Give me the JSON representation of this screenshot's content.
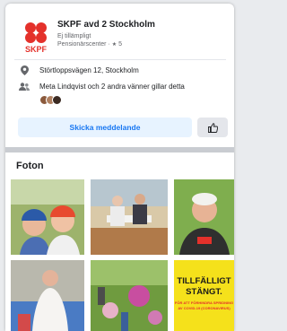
{
  "page": {
    "name": "SKPF avd 2 Stockholm",
    "status": "Ej tillämpligt",
    "category": "Pensionärscenter",
    "rating": "5",
    "logo_text": "SKPF"
  },
  "info": {
    "address": "Störtloppsvägen 12, Stockholm",
    "likes_text": "Meta Lindqvist och 2 andra vänner gillar detta"
  },
  "actions": {
    "message_label": "Skicka meddelande"
  },
  "photos": {
    "title": "Foton",
    "sign": {
      "line1": "TILLFÄLLIGT",
      "line2": "STÄNGT.",
      "line3": "FÖR ATT FÖRHINDRA SPRIDNING",
      "line4": "AV COVID-19 (CORONAVIRUS)"
    }
  },
  "colors": {
    "brand_red": "#e4312b",
    "link_blue": "#1877f2",
    "sign_yellow": "#f5e11b"
  }
}
